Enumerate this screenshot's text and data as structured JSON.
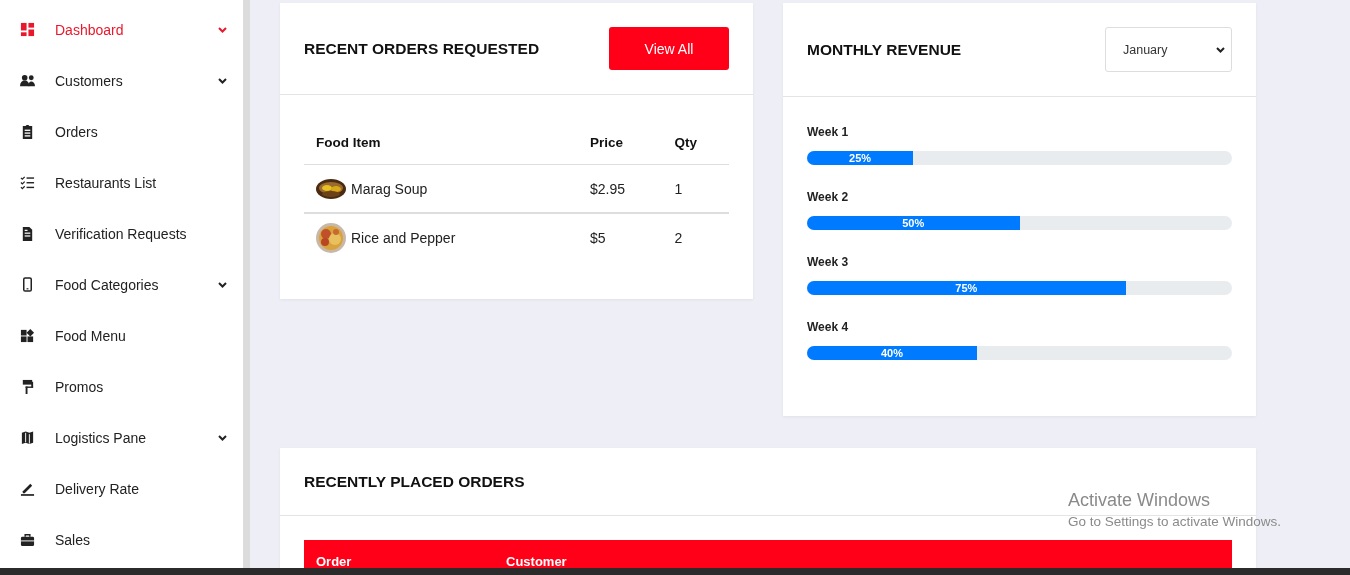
{
  "sidebar": {
    "items": [
      {
        "label": "Dashboard",
        "selected": true,
        "expandable": true
      },
      {
        "label": "Customers",
        "selected": false,
        "expandable": true
      },
      {
        "label": "Orders",
        "selected": false,
        "expandable": false
      },
      {
        "label": "Restaurants List",
        "selected": false,
        "expandable": false
      },
      {
        "label": "Verification Requests",
        "selected": false,
        "expandable": false
      },
      {
        "label": "Food Categories",
        "selected": false,
        "expandable": true
      },
      {
        "label": "Food Menu",
        "selected": false,
        "expandable": false
      },
      {
        "label": "Promos",
        "selected": false,
        "expandable": false
      },
      {
        "label": "Logistics Pane",
        "selected": false,
        "expandable": true
      },
      {
        "label": "Delivery Rate",
        "selected": false,
        "expandable": false
      },
      {
        "label": "Sales",
        "selected": false,
        "expandable": false
      }
    ]
  },
  "recent_orders": {
    "title": "RECENT ORDERS REQUESTED",
    "button": "View All",
    "columns": [
      "Food Item",
      "Price",
      "Qty"
    ],
    "rows": [
      {
        "food_item": "Marag Soup",
        "price": "$2.95",
        "qty": "1"
      },
      {
        "food_item": "Rice and Pepper",
        "price": "$5",
        "qty": "2"
      }
    ]
  },
  "monthly_revenue": {
    "title": "MONTHLY REVENUE",
    "month": "January",
    "weeks": [
      {
        "label": "Week 1",
        "level": 0.25,
        "reading": "25%"
      },
      {
        "label": "Week 2",
        "level": 0.5,
        "reading": "50%"
      },
      {
        "label": "Week 3",
        "level": 0.75,
        "reading": "75%"
      },
      {
        "label": "Week 4",
        "level": 0.4,
        "reading": "40%"
      }
    ]
  },
  "recently_placed": {
    "title": "RECENTLY PLACED ORDERS",
    "columns": [
      "Order",
      "Customer"
    ]
  },
  "os_notice": {
    "title": "Activate Windows",
    "text": "Go to Settings to activate Windows."
  }
}
